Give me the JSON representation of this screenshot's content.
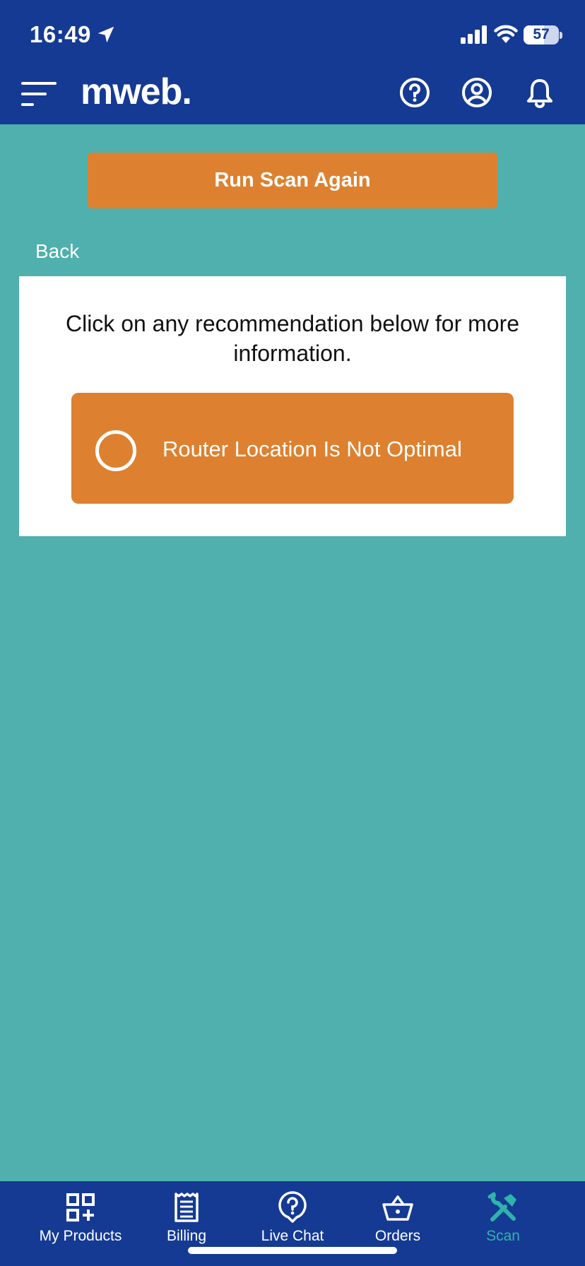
{
  "status_bar": {
    "time": "16:49",
    "battery": "57",
    "location_icon": "location-arrow-icon",
    "signal_icon": "cellular-signal-icon",
    "wifi_icon": "wifi-icon"
  },
  "header": {
    "logo": "mweb.",
    "menu_icon": "hamburger-menu-icon",
    "help_icon": "help-circle-icon",
    "account_icon": "user-circle-icon",
    "notifications_icon": "bell-icon"
  },
  "main": {
    "run_scan_label": "Run Scan Again",
    "back_label": "Back",
    "instruction": "Click on any recommendation below for more information.",
    "recommendations": [
      {
        "label": "Router Location Is Not Optimal"
      }
    ]
  },
  "tabs": [
    {
      "label": "My Products",
      "icon": "grid-plus-icon",
      "active": false
    },
    {
      "label": "Billing",
      "icon": "receipt-icon",
      "active": false
    },
    {
      "label": "Live Chat",
      "icon": "chat-question-icon",
      "active": false
    },
    {
      "label": "Orders",
      "icon": "basket-icon",
      "active": false
    },
    {
      "label": "Scan",
      "icon": "tools-icon",
      "active": true
    }
  ],
  "colors": {
    "header_bg": "#153a94",
    "page_bg": "#4fb0ae",
    "accent_orange": "#dd8130",
    "active_tab": "#2fb3ac"
  }
}
